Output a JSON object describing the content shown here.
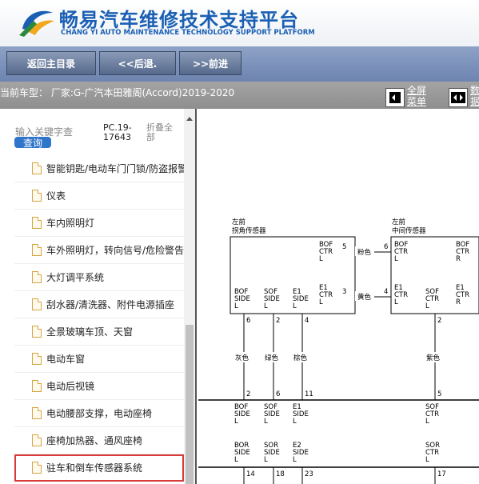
{
  "header": {
    "title_cn": "畅易汽车维修技术支持平台",
    "title_en": "CHANG YI AUTO MAINTENANCE TECHNOLOGY SUPPORT PLATFORM",
    "brand_color": "#1a5fb4"
  },
  "toolbar": {
    "back_main": "返回主目录",
    "back": "<<后退.",
    "forward": ">>前进"
  },
  "infobar": {
    "vehicle": "当前车型： 厂家:G-广汽本田雅阁(Accord)2019-2020",
    "fullscreen_menu": [
      "全屏",
      "菜单"
    ],
    "right_label": [
      "数",
      "据"
    ]
  },
  "sidebar": {
    "search_placeholder": "输入关键字查",
    "query_label": "查询",
    "pc_code": [
      "PC.19-",
      "17643"
    ],
    "fold_all": [
      "折叠全",
      "部"
    ],
    "items": [
      "智能钥匙/电动车门门锁/防盗报警",
      "仪表",
      "车内照明灯",
      "车外照明灯，转向信号/危险警告",
      "大灯调平系统",
      "刮水器/清洗器、附件电源插座",
      "全景玻璃车顶、天窗",
      "电动车窗",
      "电动后视镜",
      "电动腰部支撑，电动座椅",
      "座椅加热器、通风座椅",
      "驻车和倒车传感器系统"
    ],
    "selected_index": 11
  },
  "diagram": {
    "sensor_left_title": [
      "左前",
      "拐角传感器"
    ],
    "sensor_mid_title": [
      "左前",
      "中间传感器"
    ],
    "pin_labels_left": {
      "bof_ctr_l": [
        "BOF",
        "CTR",
        "L"
      ],
      "e1_ctr_l": [
        "E1",
        "CTR",
        "L"
      ],
      "bof_side_l": [
        "BOF",
        "SIDE",
        "L"
      ],
      "sof_side_l": [
        "SOF",
        "SIDE",
        "L"
      ],
      "e1_side_l": [
        "E1",
        "SIDE",
        "L"
      ]
    },
    "pin_labels_mid": {
      "bof_ctr_l": [
        "BOF",
        "CTR",
        "L"
      ],
      "bof_ctr_r": [
        "BOF",
        "CTR",
        "R"
      ],
      "e1_ctr_l": [
        "E1",
        "CTR",
        "L"
      ],
      "sof_ctr_l": [
        "SOF",
        "CTR",
        "L"
      ],
      "e1_ctr_r": [
        "E1",
        "CTR",
        "R"
      ]
    },
    "wire_colors": {
      "pink": "粉色",
      "yellow": "黄色",
      "gray": "灰色",
      "green": "绿色",
      "brown": "棕色",
      "purple": "紫色"
    },
    "pins": {
      "p5": "5",
      "p6a": "6",
      "p3": "3",
      "p4": "4",
      "p6b": "6",
      "p2a": "2",
      "p4b": "4",
      "p2b": "2",
      "p2c": "2",
      "p6c": "6",
      "p11": "11",
      "p5b": "5",
      "p14": "14",
      "p18": "18",
      "p23": "23",
      "p17": "17"
    },
    "lower_labels": {
      "bof_side_l": [
        "BOF",
        "SIDE",
        "L"
      ],
      "sof_side_l": [
        "SOF",
        "SIDE",
        "L"
      ],
      "e1_side_l": [
        "E1",
        "SIDE",
        "L"
      ],
      "sof_ctr_l": [
        "SOF",
        "CTR",
        "L"
      ],
      "bor_side_l": [
        "BOR",
        "SIDE",
        "L"
      ],
      "sor_side_l": [
        "SOR",
        "SIDE",
        "L"
      ],
      "e2_side_l": [
        "E2",
        "SIDE",
        "L"
      ],
      "sor_ctr_l": [
        "SOR",
        "CTR",
        "L"
      ]
    }
  }
}
